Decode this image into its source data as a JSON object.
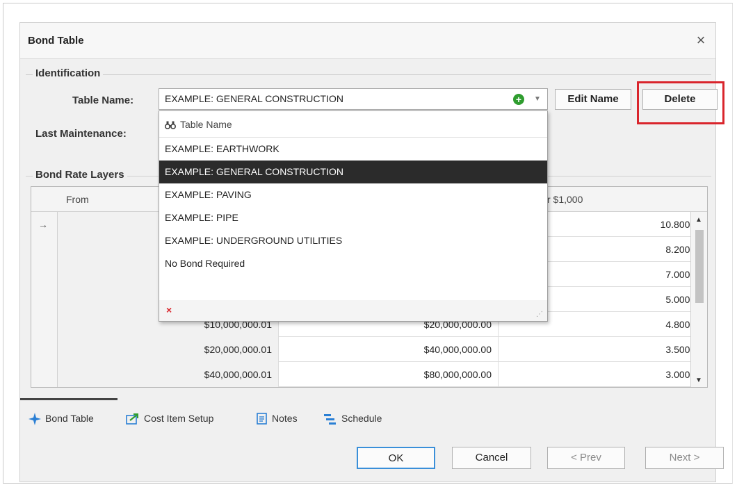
{
  "dialog": {
    "title": "Bond Table",
    "close_glyph": "×"
  },
  "identification": {
    "group_label": "Identification",
    "table_name_label": "Table Name:",
    "table_name_value": "EXAMPLE: GENERAL CONSTRUCTION",
    "add_glyph": "+",
    "last_maintenance_label": "Last Maintenance:",
    "edit_name_button": "Edit Name",
    "delete_button": "Delete"
  },
  "dropdown": {
    "header": "Table Name",
    "items": [
      "EXAMPLE: EARTHWORK",
      "EXAMPLE: GENERAL CONSTRUCTION",
      "EXAMPLE: PAVING",
      "EXAMPLE: PIPE",
      "EXAMPLE: UNDERGROUND UTILITIES",
      "No Bond Required"
    ],
    "selected_index": 1,
    "clear_glyph": "×"
  },
  "bond_rate_layers": {
    "group_label": "Bond Rate Layers",
    "columns": {
      "from": "From",
      "per_thousand_fragment": "r $1,000"
    },
    "rows": [
      {
        "from": "",
        "to": "",
        "rate": "10.80000"
      },
      {
        "from": "",
        "to": "",
        "rate": "8.20000"
      },
      {
        "from": "",
        "to": "",
        "rate": "7.00000"
      },
      {
        "from": "",
        "to": "",
        "rate": "5.00000"
      },
      {
        "from": "$10,000,000.01",
        "to": "$20,000,000.00",
        "rate": "4.80000"
      },
      {
        "from": "$20,000,000.01",
        "to": "$40,000,000.00",
        "rate": "3.50000"
      },
      {
        "from": "$40,000,000.01",
        "to": "$80,000,000.00",
        "rate": "3.00000"
      }
    ]
  },
  "tabs": [
    "Bond Table",
    "Cost Item Setup",
    "Notes",
    "Schedule"
  ],
  "footer": {
    "ok": "OK",
    "cancel": "Cancel",
    "prev": "< Prev",
    "next": "Next >"
  },
  "colors": {
    "highlight_red": "#d9252c",
    "selected_row": "#2b2b2b",
    "add_green": "#2f9d2f",
    "ok_border": "#3a8fd9",
    "tab_icon_blue": "#2a7fd4"
  }
}
